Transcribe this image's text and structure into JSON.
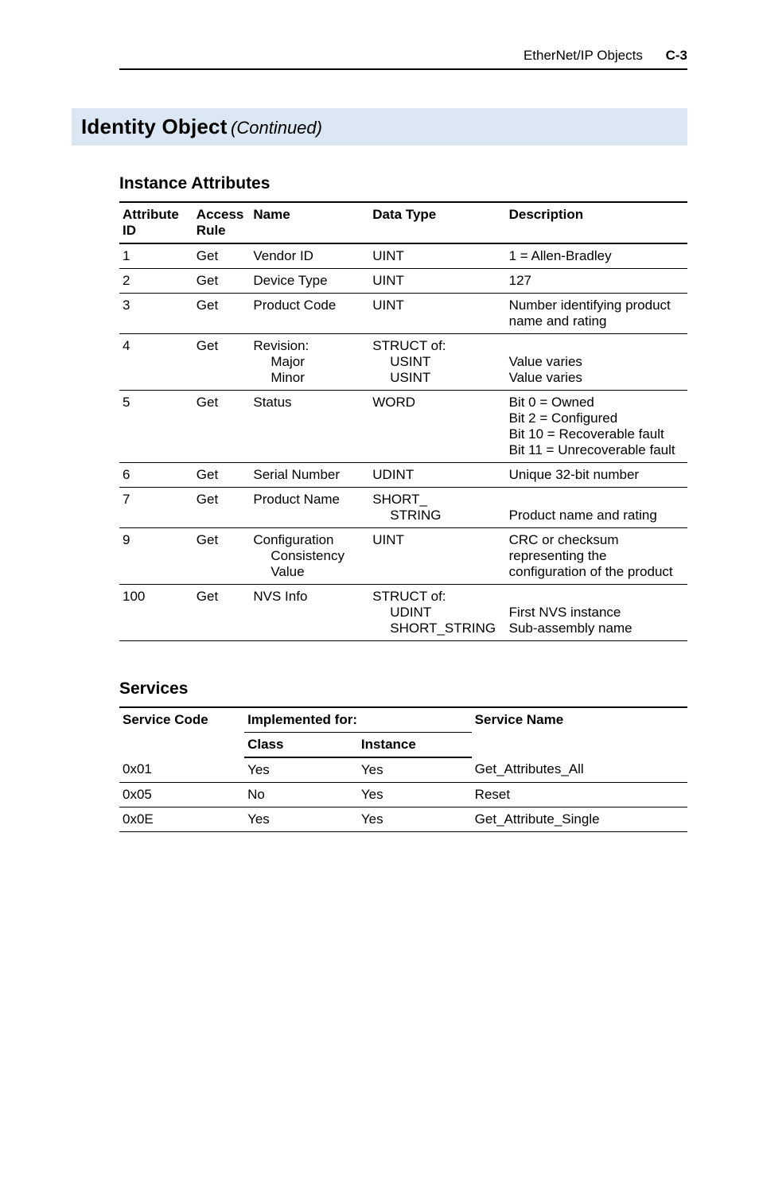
{
  "header": {
    "section": "EtherNet/IP Objects",
    "page": "C-3"
  },
  "title": {
    "main": "Identity Object",
    "cont": "(Continued)"
  },
  "instance": {
    "heading": "Instance Attributes",
    "cols": {
      "attr": "Attribute ID",
      "acc": "Access Rule",
      "name": "Name",
      "type": "Data Type",
      "desc": "Description"
    },
    "rows": [
      {
        "attr": "1",
        "acc": "Get",
        "name": "Vendor ID",
        "type": "UINT",
        "desc": "1 = Allen-Bradley"
      },
      {
        "attr": "2",
        "acc": "Get",
        "name": "Device Type",
        "type": "UINT",
        "desc": "127"
      },
      {
        "attr": "3",
        "acc": "Get",
        "name": "Product Code",
        "type": "UINT",
        "desc": "Number identifying product name and rating"
      },
      {
        "attr": "4",
        "acc": "Get",
        "name_lines": [
          "Revision:",
          "Major",
          "Minor"
        ],
        "type_lines": [
          "STRUCT of:",
          "USINT",
          "USINT"
        ],
        "desc_lines": [
          "",
          "Value varies",
          "Value varies"
        ]
      },
      {
        "attr": "5",
        "acc": "Get",
        "name": "Status",
        "type": "WORD",
        "desc_lines": [
          "Bit 0 = Owned",
          "Bit 2 = Configured",
          "Bit 10 = Recoverable fault",
          "Bit 11 = Unrecoverable fault"
        ]
      },
      {
        "attr": "6",
        "acc": "Get",
        "name": "Serial Number",
        "type": "UDINT",
        "desc": "Unique 32-bit number"
      },
      {
        "attr": "7",
        "acc": "Get",
        "name": "Product Name",
        "type_lines": [
          "SHORT_",
          "STRING"
        ],
        "desc_lines": [
          "",
          "Product name and rating"
        ]
      },
      {
        "attr": "9",
        "acc": "Get",
        "name_lines": [
          "Configuration",
          "Consistency",
          "Value"
        ],
        "type": "UINT",
        "desc": "CRC or checksum representing the configuration of the product"
      },
      {
        "attr": "100",
        "acc": "Get",
        "name": "NVS Info",
        "type_lines": [
          "STRUCT of:",
          "UDINT",
          "SHORT_STRING"
        ],
        "desc_lines": [
          "",
          "First NVS instance",
          "Sub-assembly name"
        ]
      }
    ]
  },
  "services": {
    "heading": "Services",
    "cols": {
      "sc": "Service Code",
      "impl": "Implemented for:",
      "cls": "Class",
      "inst": "Instance",
      "sn": "Service Name"
    },
    "rows": [
      {
        "sc": "0x01",
        "cls": "Yes",
        "inst": "Yes",
        "sn": "Get_Attributes_All"
      },
      {
        "sc": "0x05",
        "cls": "No",
        "inst": "Yes",
        "sn": "Reset"
      },
      {
        "sc": "0x0E",
        "cls": "Yes",
        "inst": "Yes",
        "sn": "Get_Attribute_Single"
      }
    ]
  }
}
